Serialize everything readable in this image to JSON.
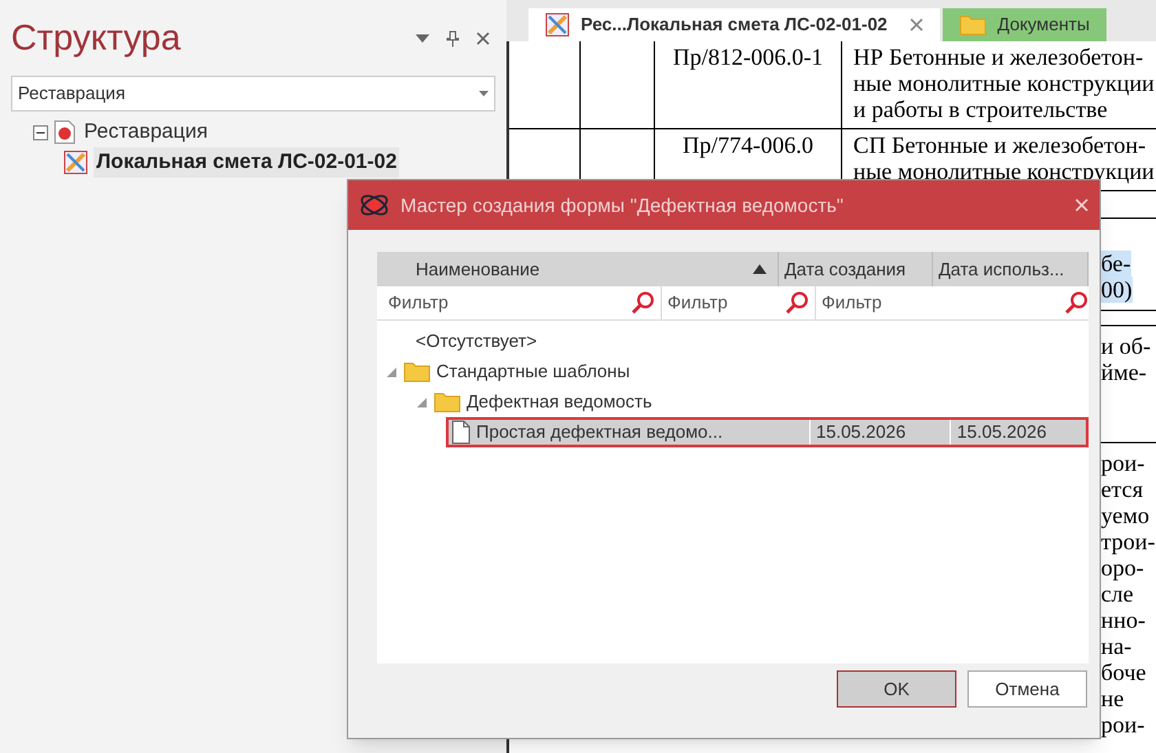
{
  "panel": {
    "title": "Структура",
    "project_select": {
      "value": "Реставрация"
    },
    "tree": [
      {
        "label": "Реставрация",
        "expanded": true,
        "children": [
          {
            "label": "Локальная смета ЛС-02-01-02",
            "selected": true
          }
        ]
      }
    ]
  },
  "tabs": [
    {
      "label": "Рес...Локальная смета ЛС-02-01-02",
      "selected": true,
      "kind": "estimate"
    },
    {
      "label": "Документы",
      "selected": false,
      "kind": "folder"
    }
  ],
  "document": {
    "rows": [
      {
        "code": "Пр/812-006.0-1",
        "lines": [
          "НР Бетонные и железобетон-",
          "ные монолитные конструкции",
          "и работы в строительстве"
        ]
      },
      {
        "code": "Пр/774-006.0",
        "lines": [
          "СП Бетонные и железобетон-",
          "ные монолитные конструкции"
        ]
      }
    ],
    "fragments": [
      {
        "kind": "rule"
      },
      {
        "kind": "gap"
      },
      {
        "kind": "text",
        "text": "бе-",
        "highlighted": true
      },
      {
        "kind": "text",
        "text": "00)",
        "highlighted": true
      },
      {
        "kind": "rule"
      },
      {
        "kind": "rule"
      },
      {
        "kind": "text",
        "text": "и об-",
        "highlighted": false
      },
      {
        "kind": "text",
        "text": "йме-",
        "highlighted": false
      },
      {
        "kind": "gap"
      },
      {
        "kind": "gap"
      },
      {
        "kind": "rule"
      },
      {
        "kind": "text",
        "text": "рои-",
        "highlighted": false
      },
      {
        "kind": "text",
        "text": "ется",
        "highlighted": false
      },
      {
        "kind": "text",
        "text": "уемо",
        "highlighted": false
      },
      {
        "kind": "text",
        "text": "трои-",
        "highlighted": false
      },
      {
        "kind": "text",
        "text": "оро-",
        "highlighted": false
      },
      {
        "kind": "text",
        "text": "сле",
        "highlighted": false
      },
      {
        "kind": "text",
        "text": "нно-",
        "highlighted": false
      },
      {
        "kind": "text",
        "text": "на-",
        "highlighted": false
      },
      {
        "kind": "text",
        "text": "боче",
        "highlighted": false
      },
      {
        "kind": "text",
        "text": "не",
        "highlighted": false
      },
      {
        "kind": "text",
        "text": "рои-",
        "highlighted": false
      }
    ]
  },
  "dialog": {
    "title": "Мастер создания формы \"Дефектная ведомость\"",
    "columns": [
      {
        "label": "Наименование",
        "sorted": true,
        "filter_placeholder": "Фильтр"
      },
      {
        "label": "Дата создания",
        "sorted": false,
        "filter_placeholder": "Фильтр"
      },
      {
        "label": "Дата использ...",
        "sorted": false,
        "filter_placeholder": "Фильтр"
      }
    ],
    "rows": [
      {
        "kind": "none",
        "label": "<Отсутствует>"
      },
      {
        "kind": "folder",
        "label": "Стандартные шаблоны",
        "expanded": true,
        "children": [
          {
            "kind": "folder",
            "label": "Дефектная ведомость",
            "expanded": true,
            "children": [
              {
                "kind": "file",
                "label": "Простая дефектная ведомо...",
                "created": "15.05.2026",
                "used": "15.05.2026",
                "selected": true
              }
            ]
          }
        ]
      }
    ],
    "buttons": [
      {
        "label": "OK",
        "default": true
      },
      {
        "label": "Отмена",
        "default": false
      }
    ]
  }
}
